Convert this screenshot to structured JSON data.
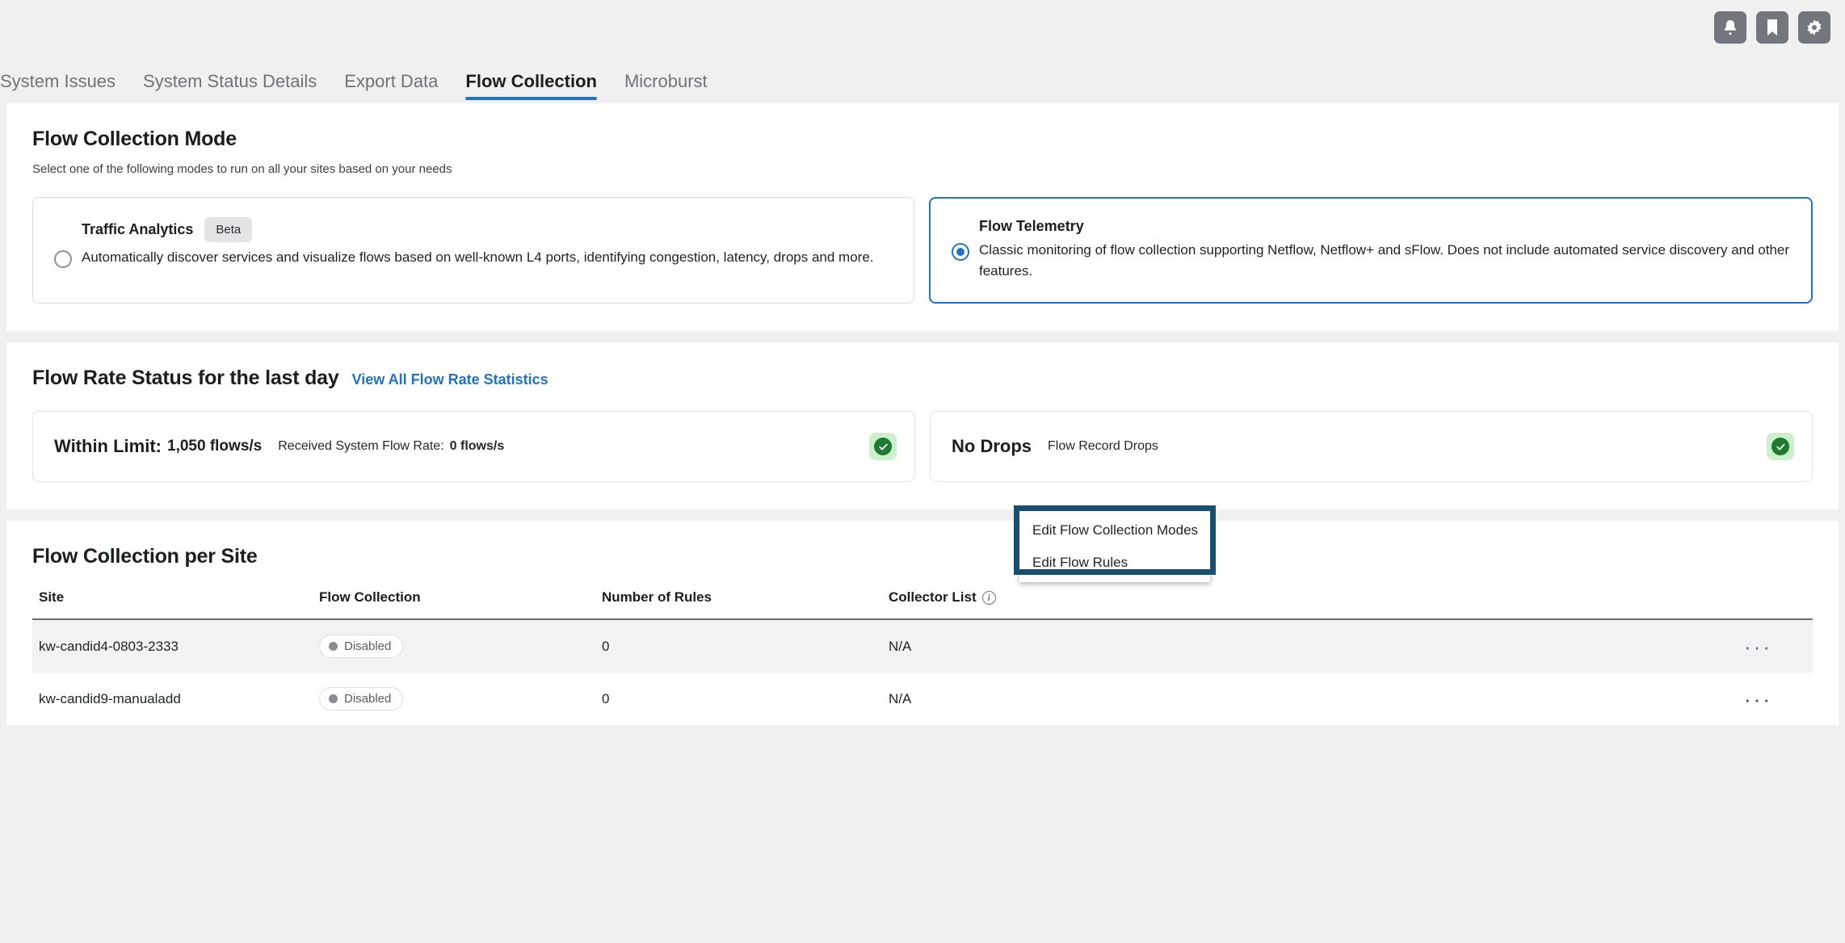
{
  "topbar": {
    "icons": [
      {
        "name": "notifications-icon",
        "label": "Notifications"
      },
      {
        "name": "bookmark-icon",
        "label": "Bookmarks"
      },
      {
        "name": "settings-gear-icon",
        "label": "Settings"
      }
    ]
  },
  "tabs": [
    {
      "label": "System Issues",
      "active": false
    },
    {
      "label": "System Status Details",
      "active": false
    },
    {
      "label": "Export Data",
      "active": false
    },
    {
      "label": "Flow Collection",
      "active": true
    },
    {
      "label": "Microburst",
      "active": false
    }
  ],
  "mode_section": {
    "title": "Flow Collection Mode",
    "subtitle": "Select one of the following modes to run on all your sites based on your needs",
    "options": [
      {
        "title": "Traffic Analytics",
        "badge": "Beta",
        "description": "Automatically discover services and visualize flows based on well-known L4 ports, identifying congestion, latency, drops and more.",
        "selected": false
      },
      {
        "title": "Flow Telemetry",
        "badge": "",
        "description": "Classic monitoring of flow collection supporting Netflow, Netflow+ and sFlow. Does not include automated service discovery and other features.",
        "selected": true
      }
    ]
  },
  "rate_section": {
    "title": "Flow Rate Status for the last day",
    "link": "View All Flow Rate Statistics",
    "cards": [
      {
        "headline": "Within Limit:",
        "value": "1,050 flows/s",
        "sub_label": "Received System Flow Rate:",
        "sub_value": "0 flows/s",
        "status": "ok"
      },
      {
        "headline": "No Drops",
        "value": "",
        "sub_label": "Flow Record Drops",
        "sub_value": "",
        "status": "ok"
      }
    ]
  },
  "site_section": {
    "title": "Flow Collection per Site",
    "columns": [
      "Site",
      "Flow Collection",
      "Number of Rules",
      "Collector List",
      ""
    ],
    "collector_info_icon": "info-icon",
    "rows": [
      {
        "site": "kw-candid4-0803-2333",
        "flow_collection": "Disabled",
        "number_of_rules": "0",
        "collector_list": "N/A",
        "actions": "···"
      },
      {
        "site": "kw-candid9-manualadd",
        "flow_collection": "Disabled",
        "number_of_rules": "0",
        "collector_list": "N/A",
        "actions": "···"
      }
    ],
    "menu": {
      "items": [
        {
          "label": "Edit Flow Collection Modes"
        },
        {
          "label": "Edit Flow Rules"
        }
      ]
    }
  },
  "colors": {
    "accent_blue": "#1f72c4",
    "link_blue": "#1f72c4",
    "status_green": "#1d7a2e",
    "status_green_bg": "#ccf0cc",
    "highlight_teal": "#17506e",
    "page_bg": "#f0f0f0"
  }
}
